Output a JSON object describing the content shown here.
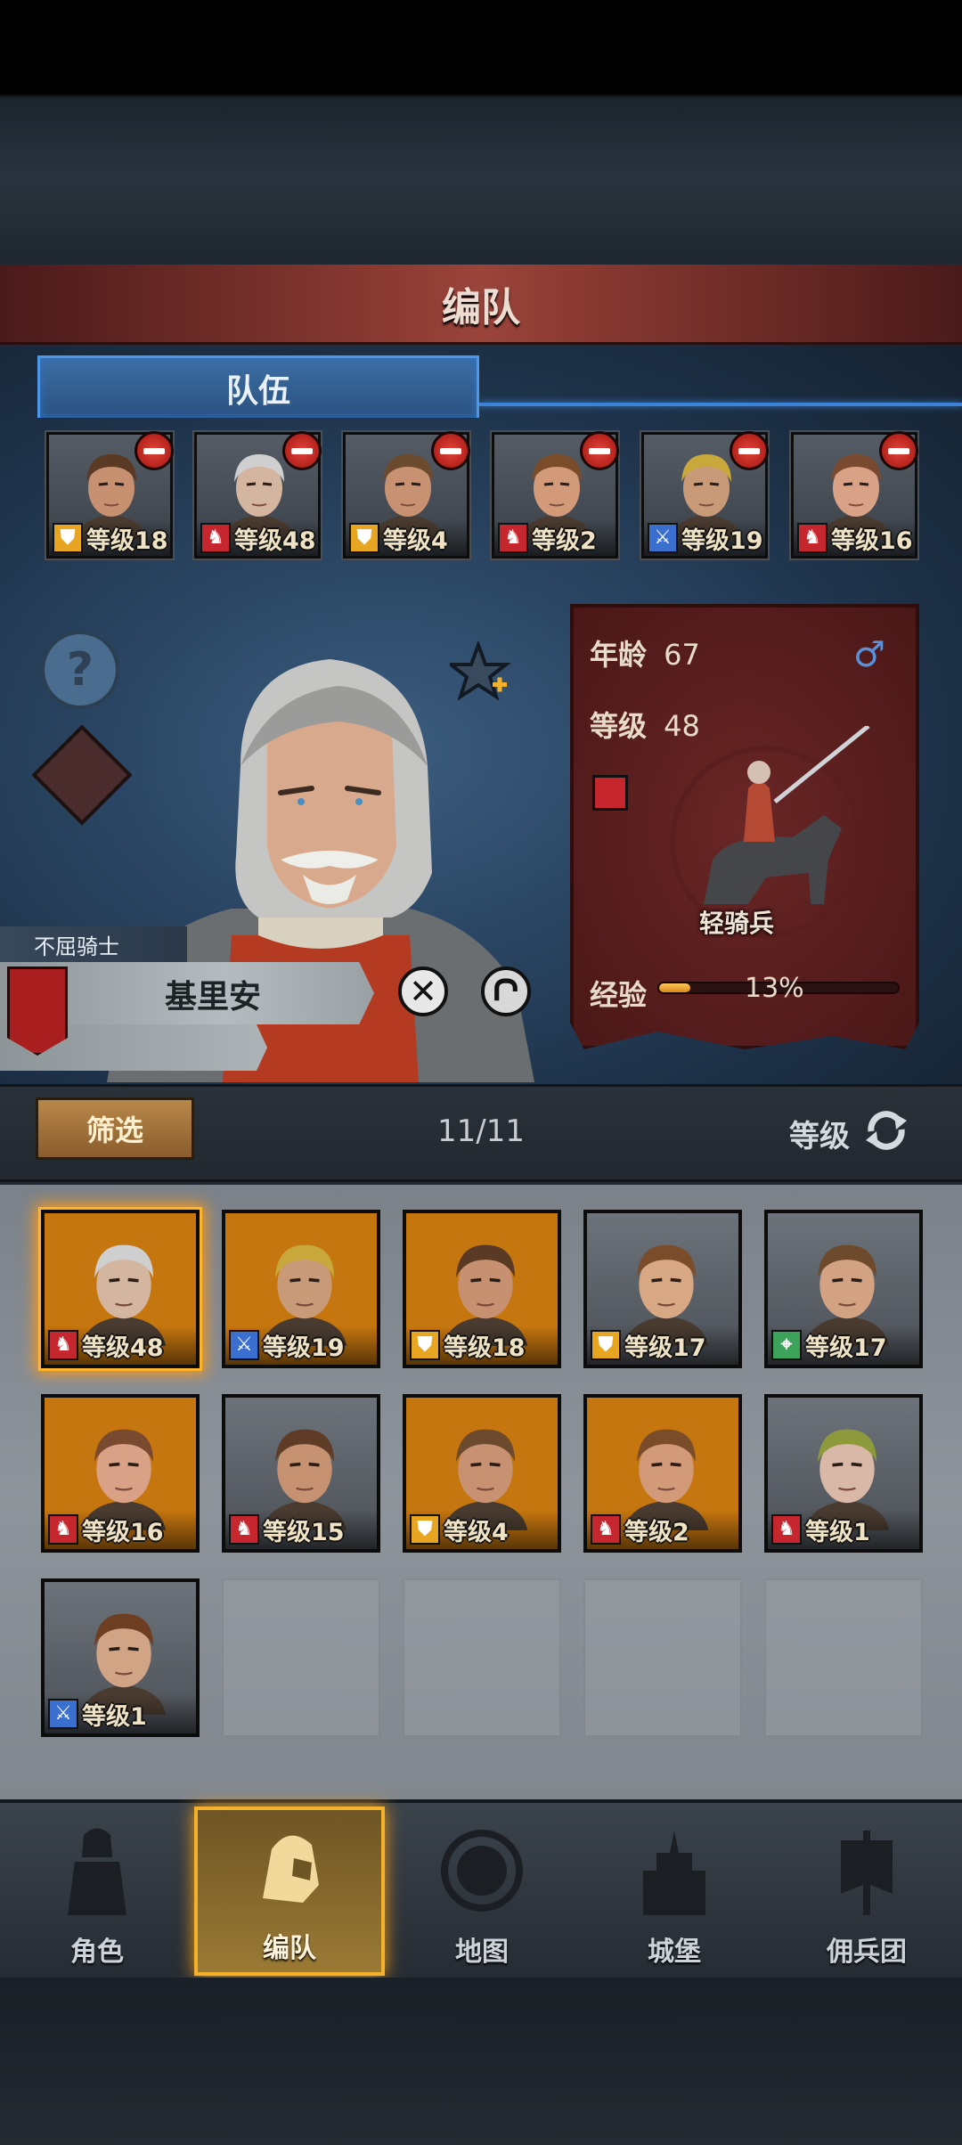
{
  "screen_title": "编队",
  "tabs": {
    "team": "队伍"
  },
  "team_slots": [
    {
      "level": "等级18",
      "cls": "shield",
      "skin": "#c79070",
      "hair": "#5a3a24"
    },
    {
      "level": "等级48",
      "cls": "horse",
      "skin": "#d4b6a0",
      "hair": "#cfcfcf"
    },
    {
      "level": "等级4",
      "cls": "shield",
      "skin": "#c89272",
      "hair": "#6b4a2e"
    },
    {
      "level": "等级2",
      "cls": "horse",
      "skin": "#d29a78",
      "hair": "#7a4c2a"
    },
    {
      "level": "等级19",
      "cls": "sword",
      "skin": "#c99a78",
      "hair": "#c8a83a"
    },
    {
      "level": "等级16",
      "cls": "horse",
      "skin": "#d9a286",
      "hair": "#7a4a30"
    }
  ],
  "hero": {
    "title": "不屈骑士",
    "name": "基里安",
    "age_label": "年龄",
    "age": "67",
    "gender": "♂",
    "level_label": "等级",
    "level": "48",
    "unit_type": "轻骑兵",
    "exp_label": "经验",
    "exp_percent_text": "13%",
    "exp_fraction": 0.13,
    "dismiss_icon": "close-icon"
  },
  "filter": {
    "label": "筛选",
    "count": "11/11",
    "sort_label": "等级"
  },
  "roster": [
    {
      "level": "等级48",
      "cls": "horse",
      "bg": "orange",
      "skin": "#d4b6a0",
      "hair": "#cfcfcf",
      "selected": true
    },
    {
      "level": "等级19",
      "cls": "sword",
      "bg": "orange",
      "skin": "#c99a78",
      "hair": "#c8a83a"
    },
    {
      "level": "等级18",
      "cls": "shield",
      "bg": "orange",
      "skin": "#c79070",
      "hair": "#5a3a24"
    },
    {
      "level": "等级17",
      "cls": "shield",
      "bg": "gray",
      "skin": "#d8a784",
      "hair": "#7a4c2a"
    },
    {
      "level": "等级17",
      "cls": "bow",
      "bg": "gray",
      "skin": "#d3a282",
      "hair": "#6e4a2c"
    },
    {
      "level": "等级16",
      "cls": "horse",
      "bg": "orange",
      "skin": "#d9a286",
      "hair": "#7a4a30"
    },
    {
      "level": "等级15",
      "cls": "horse",
      "bg": "gray",
      "skin": "#c69272",
      "hair": "#5e3c26"
    },
    {
      "level": "等级4",
      "cls": "shield",
      "bg": "orange",
      "skin": "#c89272",
      "hair": "#6b4a2e"
    },
    {
      "level": "等级2",
      "cls": "horse",
      "bg": "orange",
      "skin": "#d29a78",
      "hair": "#7a4c2a"
    },
    {
      "level": "等级1",
      "cls": "horse",
      "bg": "gray",
      "skin": "#d9b8a8",
      "hair": "#8d9a3c"
    },
    {
      "level": "等级1",
      "cls": "sword",
      "bg": "gray",
      "skin": "#d2a486",
      "hair": "#6e3e22"
    }
  ],
  "nav": [
    {
      "label": "角色",
      "icon": "knight-icon",
      "active": false
    },
    {
      "label": "编队",
      "icon": "helmet-icon",
      "active": true
    },
    {
      "label": "地图",
      "icon": "map-icon",
      "active": false
    },
    {
      "label": "城堡",
      "icon": "castle-icon",
      "active": false
    },
    {
      "label": "佣兵团",
      "icon": "banner-icon",
      "active": false
    }
  ],
  "colors": {
    "accent_blue": "#3c83d8",
    "title_red": "#8a3a32",
    "select_gold": "#f4b12c"
  }
}
